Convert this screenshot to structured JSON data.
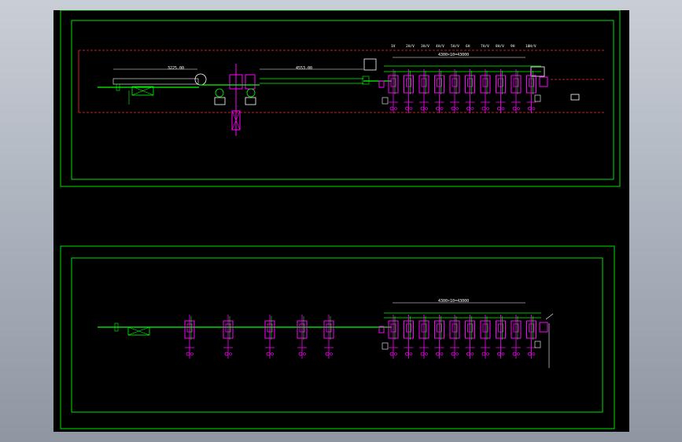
{
  "colors": {
    "background_outer": "#a9afba",
    "canvas": "#000000",
    "frame": "#00e000",
    "centerline": "#ff2a2a",
    "mill_stand": "#ff00ff",
    "conveyor": "#00ff00",
    "dimension": "#ffffff"
  },
  "sheet_top": {
    "dimension_left": "3225.00",
    "dimension_mid": "4553.00",
    "dimension_finishing": "4300×10=43000",
    "stand_labels": [
      "1V",
      "2H/V",
      "3H/V",
      "4H/V",
      "5H/V",
      "6H",
      "7H/V",
      "8H/V",
      "9H",
      "10H/V"
    ],
    "stand_count": 10
  },
  "sheet_bottom": {
    "dimension_finishing": "4300×10=43000",
    "roughing_stand_count": 5,
    "stand_count": 10
  }
}
